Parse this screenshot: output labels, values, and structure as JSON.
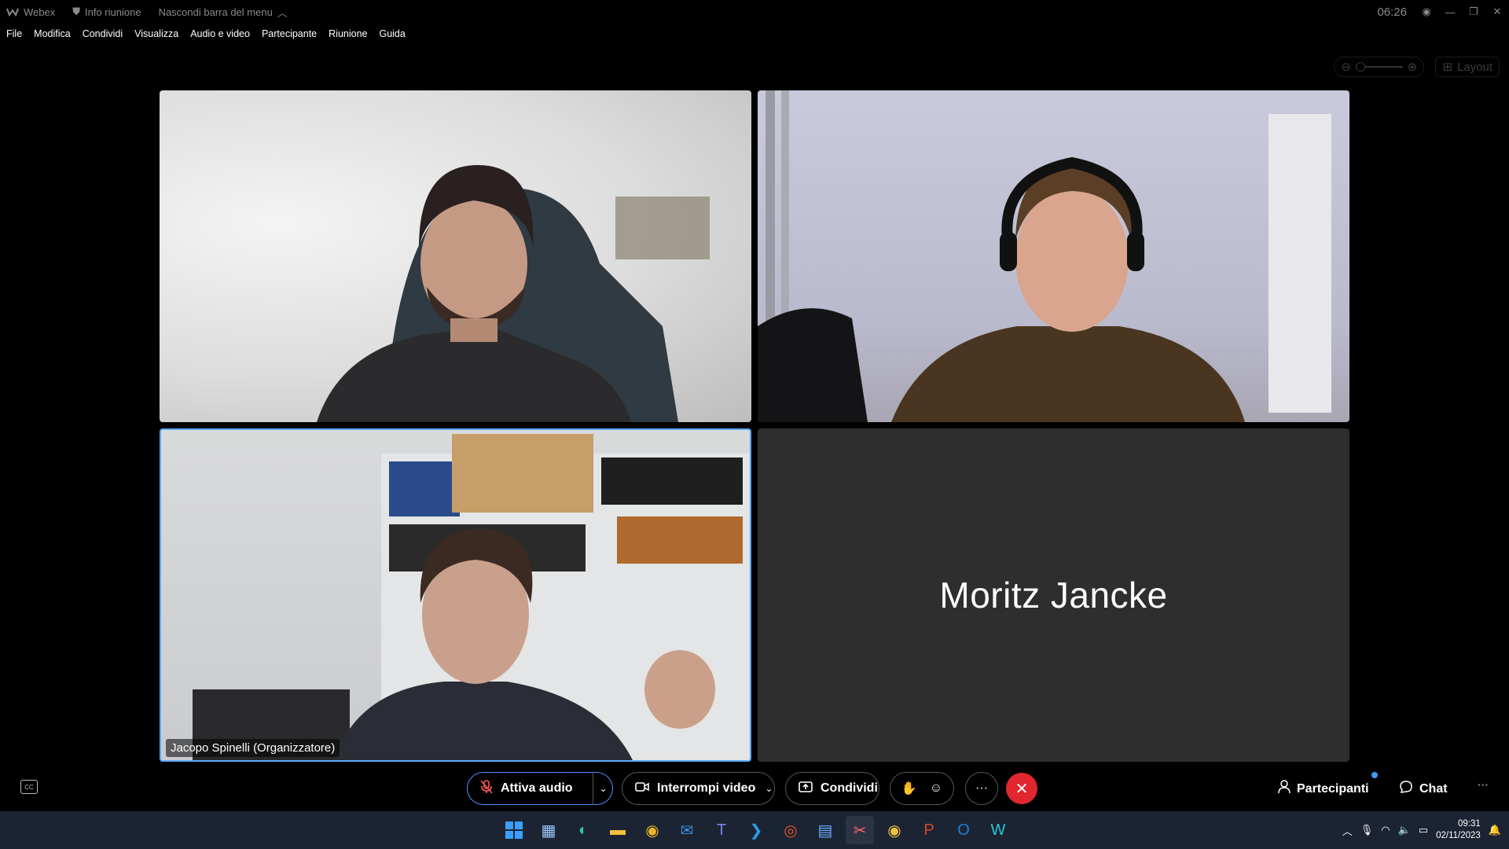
{
  "titlebar": {
    "app_name": "Webex",
    "meeting_info": "Info riunione",
    "hide_menu": "Nascondi barra del menu",
    "clock": "06:26"
  },
  "menu": [
    "File",
    "Modifica",
    "Condividi",
    "Visualizza",
    "Audio e video",
    "Partecipante",
    "Riunione",
    "Guida"
  ],
  "layout_label": "Layout",
  "tiles": {
    "organizer_label": "Jacopo Spinelli (Organizzatore)",
    "no_video_name": "Moritz Jancke"
  },
  "controls": {
    "audio": "Attiva audio",
    "video": "Interrompi video",
    "share": "Condividi",
    "participants": "Partecipanti",
    "chat": "Chat"
  },
  "taskbar": {
    "time": "09:31",
    "date": "02/11/2023"
  },
  "colors": {
    "active_speaker_border": "#5aa9ff",
    "end_call": "#e0262e",
    "notification_dot": "#3f9cff"
  }
}
